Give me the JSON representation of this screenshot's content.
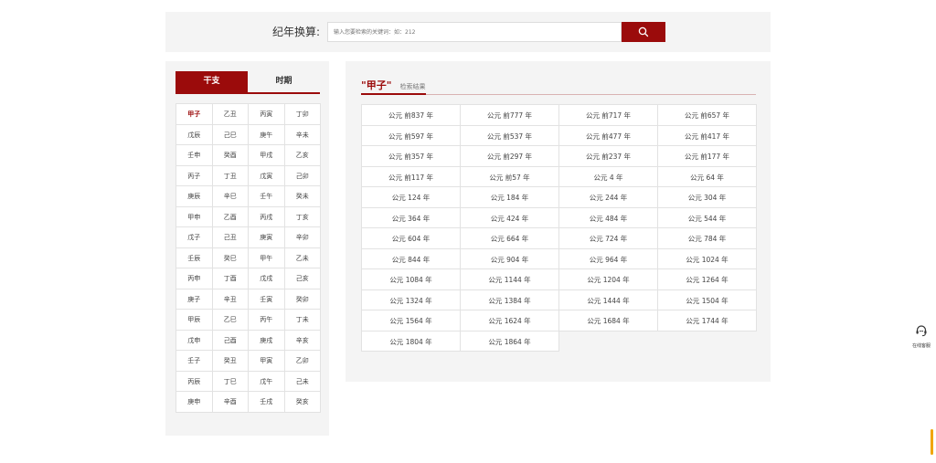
{
  "search": {
    "label": "纪年换算:",
    "placeholder": "输入您要检索的关键词：如：212",
    "button_icon": "search-icon"
  },
  "tabs": [
    {
      "label": "干支",
      "active": true
    },
    {
      "label": "时期",
      "active": false
    }
  ],
  "ganzhi": [
    "甲子",
    "乙丑",
    "丙寅",
    "丁卯",
    "戊辰",
    "己巳",
    "庚午",
    "辛未",
    "壬申",
    "癸酉",
    "甲戌",
    "乙亥",
    "丙子",
    "丁丑",
    "戊寅",
    "己卯",
    "庚辰",
    "辛巳",
    "壬午",
    "癸未",
    "甲申",
    "乙酉",
    "丙戌",
    "丁亥",
    "戊子",
    "己丑",
    "庚寅",
    "辛卯",
    "壬辰",
    "癸巳",
    "甲午",
    "乙未",
    "丙申",
    "丁酉",
    "戊戌",
    "己亥",
    "庚子",
    "辛丑",
    "壬寅",
    "癸卯",
    "甲辰",
    "乙巳",
    "丙午",
    "丁未",
    "戊申",
    "己酉",
    "庚戌",
    "辛亥",
    "壬子",
    "癸丑",
    "甲寅",
    "乙卯",
    "丙辰",
    "丁巳",
    "戊午",
    "己未",
    "庚申",
    "辛酉",
    "壬戌",
    "癸亥"
  ],
  "ganzhi_active": "甲子",
  "result": {
    "keyword": "\"甲子\"",
    "subtitle": "检索结果",
    "years": [
      "公元 前837 年",
      "公元 前777 年",
      "公元 前717 年",
      "公元 前657 年",
      "公元 前597 年",
      "公元 前537 年",
      "公元 前477 年",
      "公元 前417 年",
      "公元 前357 年",
      "公元 前297 年",
      "公元 前237 年",
      "公元 前177 年",
      "公元 前117 年",
      "公元 前57 年",
      "公元 4 年",
      "公元 64 年",
      "公元 124 年",
      "公元 184 年",
      "公元 244 年",
      "公元 304 年",
      "公元 364 年",
      "公元 424 年",
      "公元 484 年",
      "公元 544 年",
      "公元 604 年",
      "公元 664 年",
      "公元 724 年",
      "公元 784 年",
      "公元 844 年",
      "公元 904 年",
      "公元 964 年",
      "公元 1024 年",
      "公元 1084 年",
      "公元 1144 年",
      "公元 1204 年",
      "公元 1264 年",
      "公元 1324 年",
      "公元 1384 年",
      "公元 1444 年",
      "公元 1504 年",
      "公元 1564 年",
      "公元 1624 年",
      "公元 1684 年",
      "公元 1744 年",
      "公元 1804 年",
      "公元 1864 年"
    ]
  },
  "customer_service": {
    "label": "在线客服",
    "icon": "headset-icon"
  },
  "colors": {
    "accent": "#9b0b0b",
    "panel_bg": "#f4f4f4",
    "indicator": "#f0a500"
  }
}
